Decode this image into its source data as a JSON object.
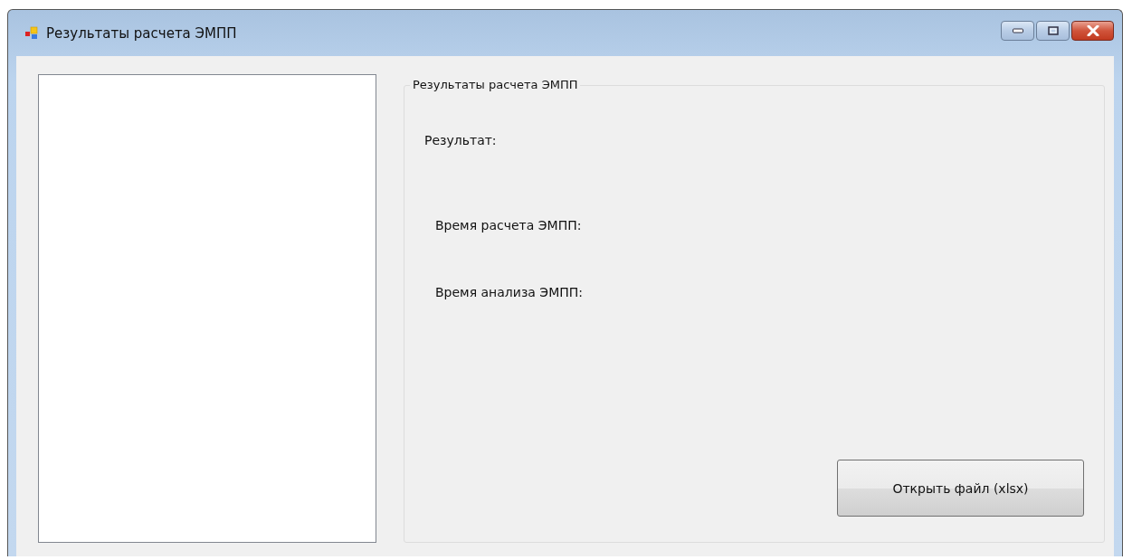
{
  "window": {
    "title": "Результаты расчета ЭМПП"
  },
  "group": {
    "title": "Результаты расчета ЭМПП",
    "labels": [
      "Результат:",
      "Время расчета ЭМПП:",
      "Время анализа ЭМПП:"
    ],
    "button": "Открыть файл (xlsx)"
  }
}
